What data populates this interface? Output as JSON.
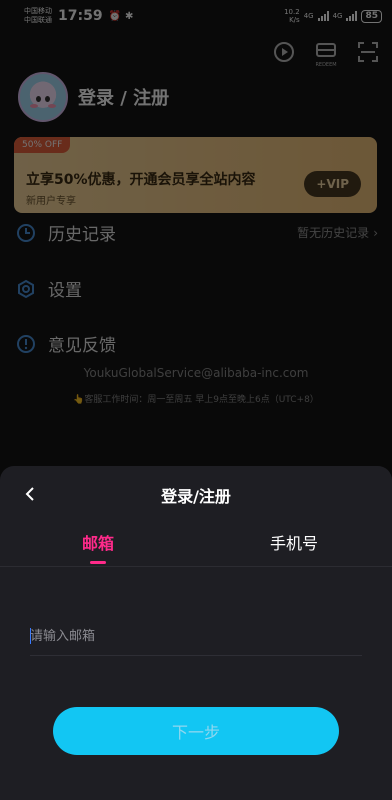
{
  "status_bar": {
    "carrier1": "中国移动",
    "carrier2": "中国联通",
    "time": "17:59",
    "net_speed_value": "10.2",
    "net_speed_unit": "K/s",
    "network_1": "4G",
    "network_2": "4G",
    "battery": "85"
  },
  "top_icons": {
    "redeem_label": "REDEEM"
  },
  "profile": {
    "login_register": "登录 / 注册"
  },
  "vip_banner": {
    "tag": "50% OFF",
    "title": "立享50%优惠，开通会员享全站内容",
    "subtitle": "新用户专享",
    "button": "+VIP"
  },
  "menu": {
    "history_label": "历史记录",
    "history_right": "暂无历史记录",
    "settings_label": "设置",
    "feedback_label": "意见反馈"
  },
  "contact": {
    "email": "YoukuGlobalService@alibaba-inc.com",
    "hours": "👆客服工作时间：周一至周五 早上9点至晚上6点（UTC+8）"
  },
  "sheet": {
    "title": "登录/注册",
    "tabs": [
      {
        "label": "邮箱",
        "active": true
      },
      {
        "label": "手机号",
        "active": false
      }
    ],
    "email_placeholder": "请输入邮箱",
    "email_value": "",
    "next_button": "下一步"
  },
  "colors": {
    "accent_pink": "#ff2a8a",
    "button_cyan": "#12c6f3",
    "vip_gold": "#f0c27b",
    "menu_icon_blue": "#4a90d9"
  }
}
